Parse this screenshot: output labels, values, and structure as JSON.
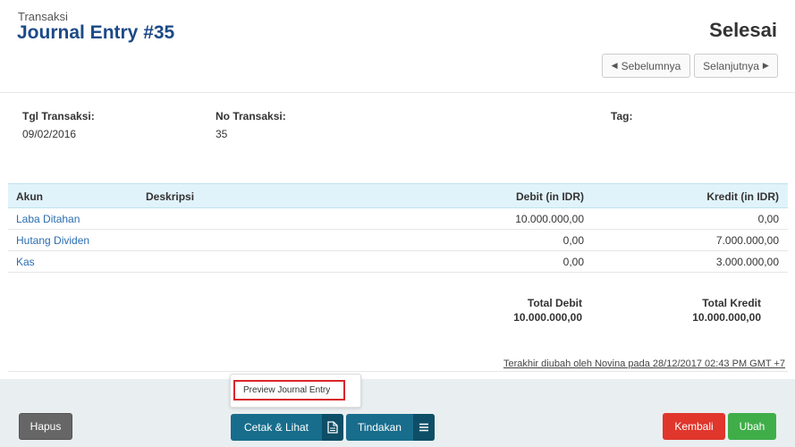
{
  "header": {
    "breadcrumb": "Transaksi",
    "title": "Journal Entry #35",
    "status": "Selesai",
    "prev_label": "Sebelumnya",
    "next_label": "Selanjutnya"
  },
  "meta": {
    "date_label": "Tgl Transaksi:",
    "date_value": "09/02/2016",
    "number_label": "No Transaksi:",
    "number_value": "35",
    "tag_label": "Tag:"
  },
  "table": {
    "headers": {
      "akun": "Akun",
      "deskripsi": "Deskripsi",
      "debit": "Debit (in IDR)",
      "kredit": "Kredit (in IDR)"
    },
    "rows": [
      {
        "akun": "Laba Ditahan",
        "deskripsi": "",
        "debit": "10.000.000,00",
        "kredit": "0,00"
      },
      {
        "akun": "Hutang Dividen",
        "deskripsi": "",
        "debit": "0,00",
        "kredit": "7.000.000,00"
      },
      {
        "akun": "Kas",
        "deskripsi": "",
        "debit": "0,00",
        "kredit": "3.000.000,00"
      }
    ]
  },
  "totals": {
    "debit_label": "Total Debit",
    "debit_value": "10.000.000,00",
    "kredit_label": "Total Kredit",
    "kredit_value": "10.000.000,00"
  },
  "last_edited": "Terakhir diubah oleh Novina pada 28/12/2017 02:43 PM GMT +7",
  "popup": {
    "item": "Preview Journal Entry"
  },
  "footer": {
    "hapus": "Hapus",
    "cetak": "Cetak & Lihat",
    "tindakan": "Tindakan",
    "kembali": "Kembali",
    "ubah": "Ubah"
  },
  "colors": {
    "title": "#1c4a86",
    "link": "#2a6db0",
    "primary": "#186d8c",
    "danger": "#e0362c",
    "success": "#3fae49",
    "table_header": "#e1f3fa"
  },
  "icons": {
    "prev": "caret-left-icon",
    "next": "caret-right-icon",
    "cetak": "document-icon",
    "tindakan": "menu-icon"
  }
}
